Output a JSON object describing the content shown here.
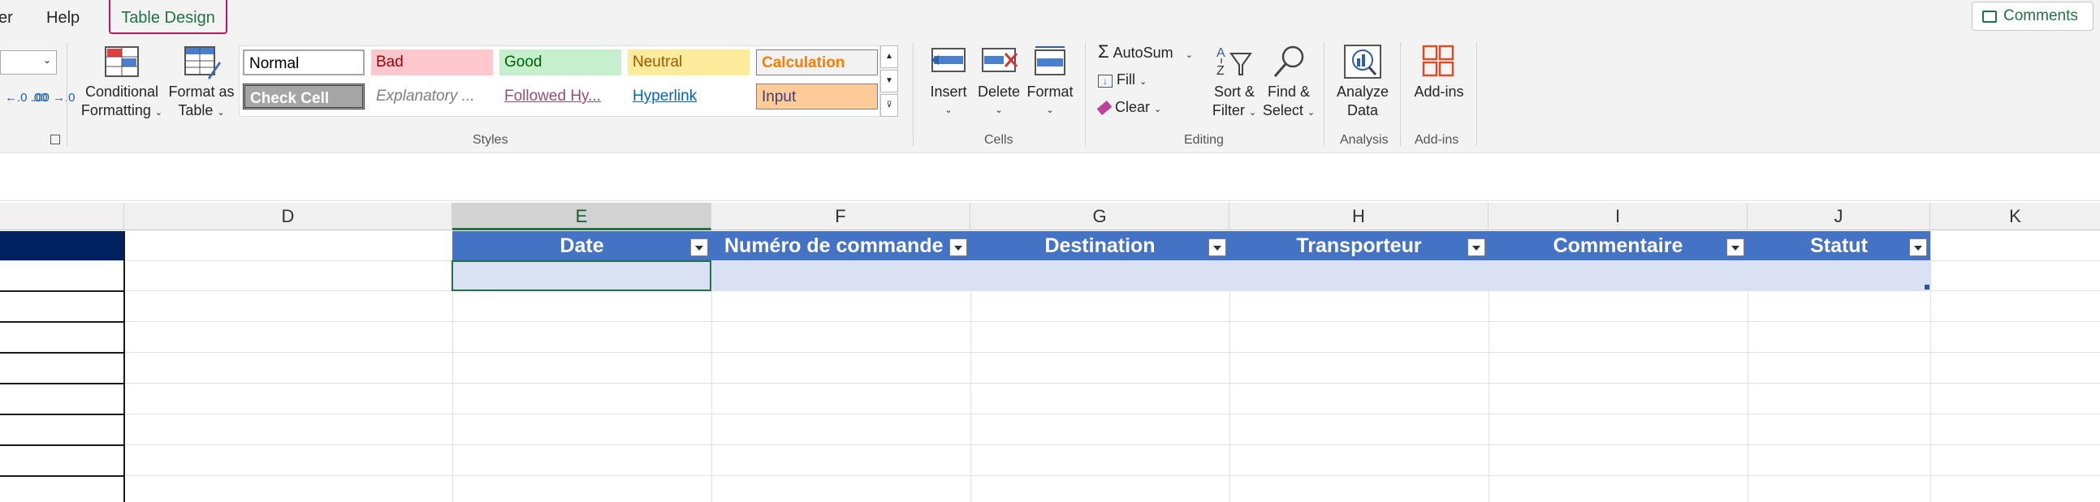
{
  "tabs": {
    "partial": "er",
    "help": "Help",
    "table_design": "Table Design"
  },
  "comments_label": "Comments",
  "number_format": {
    "increase_decimal": "←.0 .00",
    "decrease_decimal": ".00 →.0"
  },
  "styles_group": {
    "conditional_formatting": [
      "Conditional",
      "Formatting"
    ],
    "format_as_table": [
      "Format as",
      "Table"
    ],
    "label": "Styles",
    "cells": [
      {
        "label": "Normal",
        "bg": "#ffffff",
        "color": "#000000"
      },
      {
        "label": "Bad",
        "bg": "#ffc7ce",
        "color": "#9c0006"
      },
      {
        "label": "Good",
        "bg": "#c6efce",
        "color": "#006100"
      },
      {
        "label": "Neutral",
        "bg": "#ffeb9c",
        "color": "#9c5700"
      },
      {
        "label": "Calculation",
        "bg": "#f2f2f2",
        "color": "#fa7d00"
      },
      {
        "label": "Check Cell",
        "bg": "#a5a5a5",
        "color": "#ffffff"
      },
      {
        "label": "Explanatory ...",
        "bg": "#ffffff",
        "color": "#7f7f7f"
      },
      {
        "label": "Followed Hy...",
        "bg": "#ffffff",
        "color": "#954f72"
      },
      {
        "label": "Hyperlink",
        "bg": "#ffffff",
        "color": "#0563c1"
      },
      {
        "label": "Input",
        "bg": "#ffcc99",
        "color": "#3f3f76"
      }
    ]
  },
  "cells_group": {
    "insert": "Insert",
    "delete": "Delete",
    "format": "Format",
    "label": "Cells"
  },
  "editing_group": {
    "autosum": "AutoSum",
    "fill": "Fill",
    "clear": "Clear",
    "sort_filter": [
      "Sort &",
      "Filter"
    ],
    "find_select": [
      "Find &",
      "Select"
    ],
    "label": "Editing"
  },
  "analysis_group": {
    "analyze_data": [
      "Analyze",
      "Data"
    ],
    "label": "Analysis"
  },
  "addins_group": {
    "addins": "Add-ins",
    "label": "Add-ins"
  },
  "columns": [
    "D",
    "E",
    "F",
    "G",
    "H",
    "I",
    "J",
    "K"
  ],
  "selected_column": "E",
  "table": {
    "headers": [
      "Date",
      "Numéro de commande",
      "Destination",
      "Transporteur",
      "Commentaire",
      "Statut"
    ],
    "header_color": "#4472c4",
    "band_color": "#d9e1f2"
  },
  "colors": {
    "accent": "#217346",
    "highlight_border": "#c2185b"
  }
}
